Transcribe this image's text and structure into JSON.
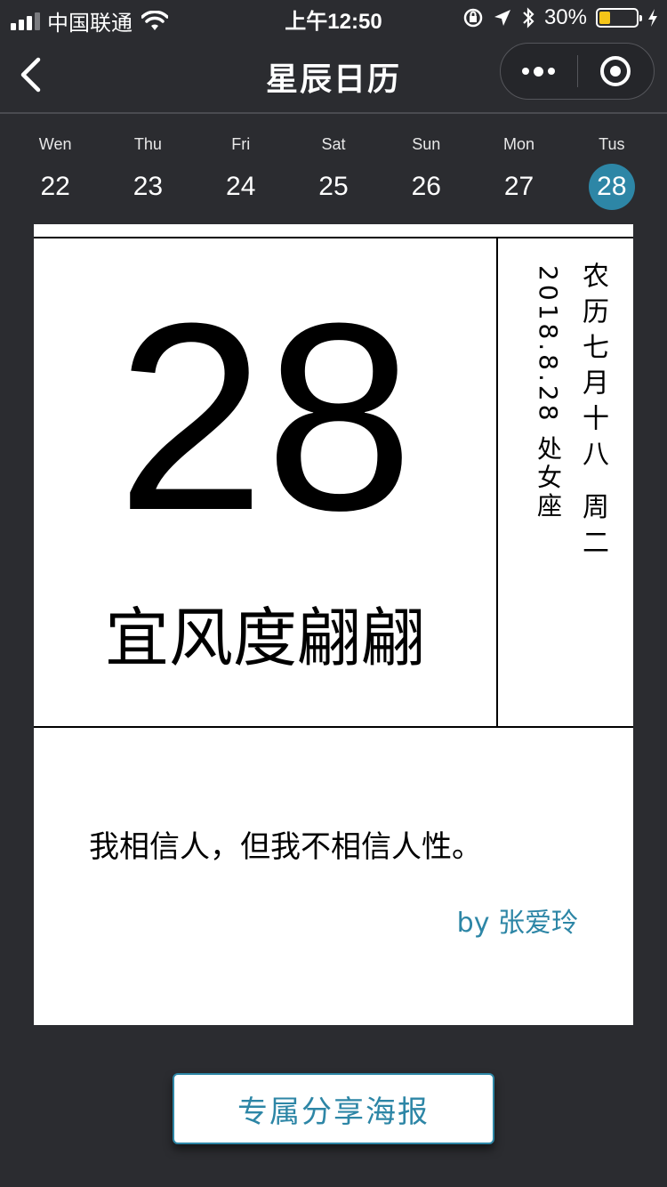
{
  "status_bar": {
    "carrier": "中国联通",
    "time": "上午12:50",
    "battery_percent": "30%",
    "battery_level": 0.3
  },
  "nav": {
    "title": "星辰日历",
    "icons": {
      "back": "chevron-left-icon",
      "more": "more-dots-icon",
      "close": "target-circle-icon"
    }
  },
  "week": {
    "days": [
      {
        "name": "Wen",
        "num": "22"
      },
      {
        "name": "Thu",
        "num": "23"
      },
      {
        "name": "Fri",
        "num": "24"
      },
      {
        "name": "Sat",
        "num": "25"
      },
      {
        "name": "Sun",
        "num": "26"
      },
      {
        "name": "Mon",
        "num": "27"
      },
      {
        "name": "Tus",
        "num": "28"
      }
    ],
    "selected_index": 6,
    "selected_color": "#2d86a6"
  },
  "card": {
    "big_date": "28",
    "yi": "宜风度翩翩",
    "lunar": "农历七月十八 周二",
    "solar": "2018.8.28  处女座",
    "quote": "我相信人，但我不相信人性。",
    "author": "by 张爱玲"
  },
  "share": {
    "label": "专属分享海报"
  },
  "colors": {
    "background": "#2b2c30",
    "accent": "#2d86a6",
    "battery": "#f5c518"
  }
}
